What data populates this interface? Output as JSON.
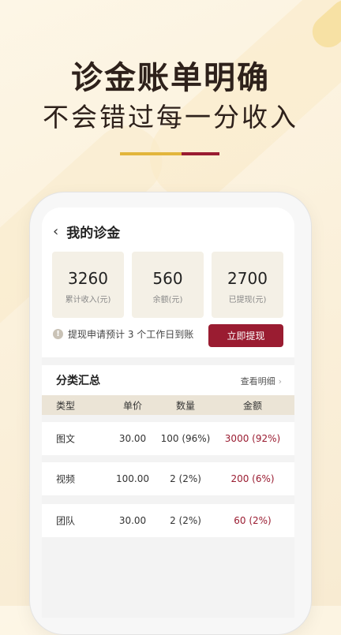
{
  "hero": {
    "title": "诊金账单明确",
    "subtitle": "不会错过每一分收入"
  },
  "colors": {
    "accent_red": "#9a1c31",
    "accent_gold": "#e2b53b",
    "card_bg": "#f4f0e6"
  },
  "page": {
    "title": "我的诊金",
    "back_icon": "chevron-left-icon"
  },
  "stats": [
    {
      "value": "3260",
      "label": "累计收入(元)"
    },
    {
      "value": "560",
      "label": "余额(元)"
    },
    {
      "value": "2700",
      "label": "已提现(元)"
    }
  ],
  "notice": {
    "icon": "info-icon",
    "text": "提现申请预计 3 个工作日到账"
  },
  "withdraw_button": "立即提现",
  "summary": {
    "title": "分类汇总",
    "link": "查看明细",
    "headers": [
      "类型",
      "单价",
      "数量",
      "金额"
    ],
    "rows": [
      [
        "图文",
        "30.00",
        "100 (96%)",
        "3000 (92%)"
      ],
      [
        "视频",
        "100.00",
        "2 (2%)",
        "200 (6%)"
      ],
      [
        "团队",
        "30.00",
        "2 (2%)",
        "60 (2%)"
      ]
    ]
  }
}
